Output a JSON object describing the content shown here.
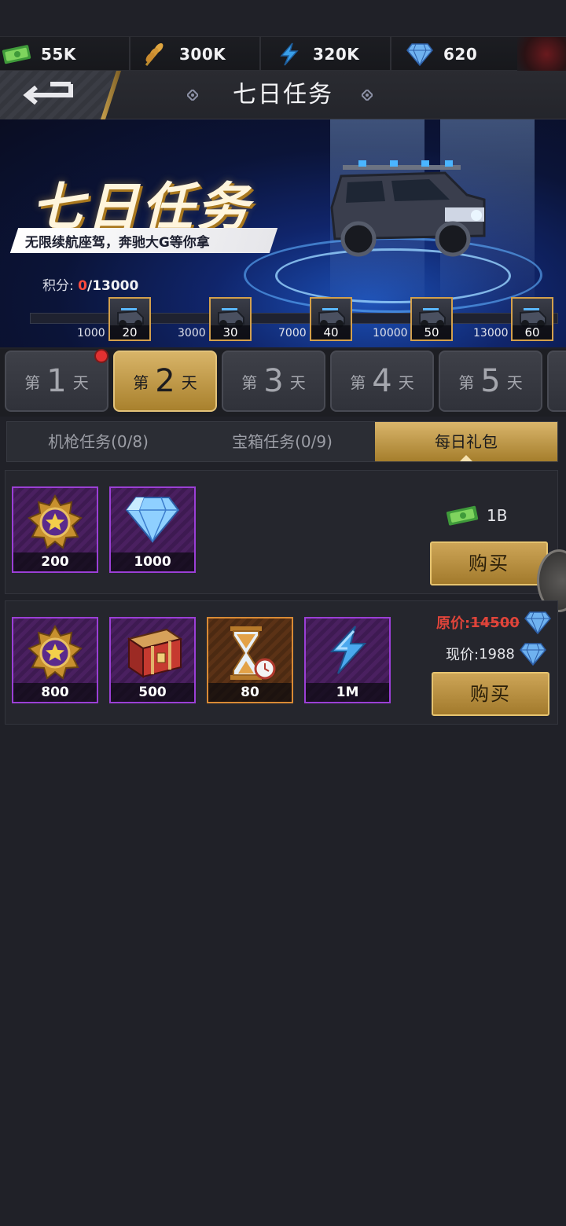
{
  "resources": [
    {
      "icon": "cash-icon",
      "value": "55K"
    },
    {
      "icon": "wheat-icon",
      "value": "300K"
    },
    {
      "icon": "energy-bolt-icon",
      "value": "320K"
    },
    {
      "icon": "diamond-icon",
      "value": "620"
    }
  ],
  "header": {
    "title": "七日任务"
  },
  "banner": {
    "title": "七日任务",
    "subtitle": "无限续航座驾，奔驰大G等你拿",
    "score_label": "积分:",
    "score_current": "0",
    "score_total": "/13000",
    "milestones": [
      {
        "threshold": "1000",
        "reward": "20"
      },
      {
        "threshold": "3000",
        "reward": "30"
      },
      {
        "threshold": "7000",
        "reward": "40"
      },
      {
        "threshold": "10000",
        "reward": "50"
      },
      {
        "threshold": "13000",
        "reward": "60"
      }
    ]
  },
  "days": [
    {
      "pre": "第",
      "num": "1",
      "suf": "天",
      "active": false,
      "has_notice": true
    },
    {
      "pre": "第",
      "num": "2",
      "suf": "天",
      "active": true,
      "has_notice": false
    },
    {
      "pre": "第",
      "num": "3",
      "suf": "天",
      "active": false,
      "has_notice": false
    },
    {
      "pre": "第",
      "num": "4",
      "suf": "天",
      "active": false,
      "has_notice": false
    },
    {
      "pre": "第",
      "num": "5",
      "suf": "天",
      "active": false,
      "has_notice": false
    }
  ],
  "subtabs": [
    {
      "label": "机枪任务(0/8)",
      "active": false
    },
    {
      "label": "宝箱任务(0/9)",
      "active": false
    },
    {
      "label": "每日礼包",
      "active": true
    }
  ],
  "packages": [
    {
      "items": [
        {
          "icon": "star-medal-icon",
          "qty": "200",
          "rarity": "purple"
        },
        {
          "icon": "diamond-icon",
          "qty": "1000",
          "rarity": "purple"
        }
      ],
      "price": "1B",
      "price_icon": "cash-icon",
      "buy_label": "购买"
    },
    {
      "items": [
        {
          "icon": "star-medal-icon",
          "qty": "800",
          "rarity": "purple"
        },
        {
          "icon": "treasure-chest-icon",
          "qty": "500",
          "rarity": "purple"
        },
        {
          "icon": "hourglass-icon",
          "qty": "80",
          "rarity": "orange"
        },
        {
          "icon": "energy-bolt-icon",
          "qty": "1M",
          "rarity": "purple"
        }
      ],
      "original_label": "原价:",
      "original_price": "14500",
      "current_label": "现价:",
      "current_price": "1988",
      "price_icon": "diamond-icon",
      "buy_label": "购买"
    }
  ],
  "colors": {
    "accent_gold": "#c9a24e",
    "rarity_purple": "#9b3fd6",
    "rarity_orange": "#d98a35",
    "alert_red": "#e0443a"
  }
}
